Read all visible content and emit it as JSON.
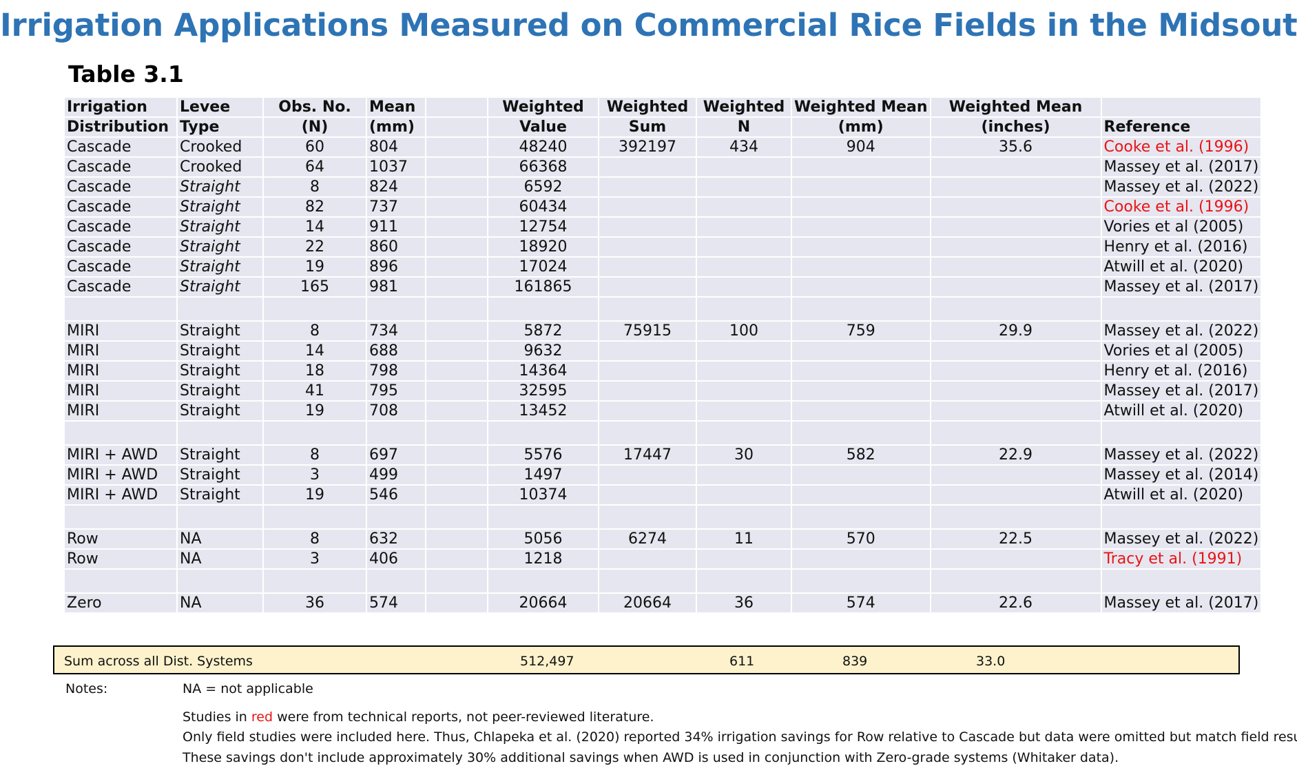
{
  "title": "Irrigation Applications Measured on Commercial Rice Fields in the Midsouth",
  "table_label": "Table 3.1",
  "headers": {
    "row1": [
      "Irrigation",
      "Levee",
      "Obs. No.",
      "Mean",
      "",
      "Weighted",
      "Weighted",
      "Weighted",
      "Weighted Mean",
      "Weighted Mean",
      ""
    ],
    "row2": [
      "Distribution",
      "Type",
      "(N)",
      "(mm)",
      "",
      "Value",
      "Sum",
      "N",
      "(mm)",
      "(inches)",
      "Reference"
    ]
  },
  "rows": [
    {
      "dist": "Cascade",
      "levee": "Crooked",
      "italic": false,
      "n": "60",
      "mean": "804",
      "value": "48240",
      "sum": "392197",
      "wn": "434",
      "wmm": "904",
      "win": "35.6",
      "ref": "Cooke et al. (1996)",
      "red": true
    },
    {
      "dist": "Cascade",
      "levee": "Crooked",
      "italic": false,
      "n": "64",
      "mean": "1037",
      "value": "66368",
      "sum": "",
      "wn": "",
      "wmm": "",
      "win": "",
      "ref": "Massey et al. (2017)",
      "red": false
    },
    {
      "dist": "Cascade",
      "levee": "Straight",
      "italic": true,
      "n": "8",
      "mean": "824",
      "value": "6592",
      "sum": "",
      "wn": "",
      "wmm": "",
      "win": "",
      "ref": "Massey et al. (2022)",
      "red": false
    },
    {
      "dist": "Cascade",
      "levee": "Straight",
      "italic": true,
      "n": "82",
      "mean": "737",
      "value": "60434",
      "sum": "",
      "wn": "",
      "wmm": "",
      "win": "",
      "ref": "Cooke et al. (1996)",
      "red": true
    },
    {
      "dist": "Cascade",
      "levee": "Straight",
      "italic": true,
      "n": "14",
      "mean": "911",
      "value": "12754",
      "sum": "",
      "wn": "",
      "wmm": "",
      "win": "",
      "ref": "Vories et  al (2005)",
      "red": false
    },
    {
      "dist": "Cascade",
      "levee": "Straight",
      "italic": true,
      "n": "22",
      "mean": "860",
      "value": "18920",
      "sum": "",
      "wn": "",
      "wmm": "",
      "win": "",
      "ref": "Henry et al. (2016)",
      "red": false
    },
    {
      "dist": "Cascade",
      "levee": "Straight",
      "italic": true,
      "n": "19",
      "mean": "896",
      "value": "17024",
      "sum": "",
      "wn": "",
      "wmm": "",
      "win": "",
      "ref": "Atwill et al. (2020)",
      "red": false
    },
    {
      "dist": "Cascade",
      "levee": "Straight",
      "italic": true,
      "n": "165",
      "mean": "981",
      "value": "161865",
      "sum": "",
      "wn": "",
      "wmm": "",
      "win": "",
      "ref": "Massey et al. (2017)",
      "red": false
    },
    {
      "blank": true
    },
    {
      "dist": "MIRI",
      "levee": "Straight",
      "italic": false,
      "n": "8",
      "mean": "734",
      "value": "5872",
      "sum": "75915",
      "wn": "100",
      "wmm": "759",
      "win": "29.9",
      "ref": "Massey et al. (2022)",
      "red": false
    },
    {
      "dist": "MIRI",
      "levee": "Straight",
      "italic": false,
      "n": "14",
      "mean": "688",
      "value": "9632",
      "sum": "",
      "wn": "",
      "wmm": "",
      "win": "",
      "ref": "Vories et  al (2005)",
      "red": false
    },
    {
      "dist": "MIRI",
      "levee": "Straight",
      "italic": false,
      "n": "18",
      "mean": "798",
      "value": "14364",
      "sum": "",
      "wn": "",
      "wmm": "",
      "win": "",
      "ref": "Henry et al. (2016)",
      "red": false
    },
    {
      "dist": "MIRI",
      "levee": "Straight",
      "italic": false,
      "n": "41",
      "mean": "795",
      "value": "32595",
      "sum": "",
      "wn": "",
      "wmm": "",
      "win": "",
      "ref": "Massey et al. (2017)",
      "red": false
    },
    {
      "dist": "MIRI",
      "levee": "Straight",
      "italic": false,
      "n": "19",
      "mean": "708",
      "value": "13452",
      "sum": "",
      "wn": "",
      "wmm": "",
      "win": "",
      "ref": "Atwill et al. (2020)",
      "red": false
    },
    {
      "blank": true
    },
    {
      "dist": "MIRI + AWD",
      "levee": "Straight",
      "italic": false,
      "n": "8",
      "mean": "697",
      "value": "5576",
      "sum": "17447",
      "wn": "30",
      "wmm": "582",
      "win": "22.9",
      "ref": "Massey et al. (2022)",
      "red": false
    },
    {
      "dist": "MIRI + AWD",
      "levee": "Straight",
      "italic": false,
      "n": "3",
      "mean": "499",
      "value": "1497",
      "sum": "",
      "wn": "",
      "wmm": "",
      "win": "",
      "ref": "Massey et al. (2014)",
      "red": false
    },
    {
      "dist": "MIRI + AWD",
      "levee": "Straight",
      "italic": false,
      "n": "19",
      "mean": "546",
      "value": "10374",
      "sum": "",
      "wn": "",
      "wmm": "",
      "win": "",
      "ref": "Atwill et al. (2020)",
      "red": false
    },
    {
      "blank": true
    },
    {
      "dist": "Row",
      "levee": "NA",
      "italic": false,
      "n": "8",
      "mean": "632",
      "value": "5056",
      "sum": "6274",
      "wn": "11",
      "wmm": "570",
      "win": "22.5",
      "ref": "Massey et al. (2022)",
      "red": false
    },
    {
      "dist": "Row",
      "levee": "NA",
      "italic": false,
      "n": "3",
      "mean": "406",
      "value": "1218",
      "sum": "",
      "wn": "",
      "wmm": "",
      "win": "",
      "ref": "Tracy et al. (1991)",
      "red": true
    },
    {
      "blank": true
    },
    {
      "dist": "Zero",
      "levee": "NA",
      "italic": false,
      "n": "36",
      "mean": "574",
      "value": "20664",
      "sum": "20664",
      "wn": "36",
      "wmm": "574",
      "win": "22.6",
      "ref": "Massey et al. (2017)",
      "red": false
    }
  ],
  "summary": {
    "label": "Sum across all Dist. Systems",
    "value": "512,497",
    "n": "611",
    "mean_mm": "839",
    "mean_in": "33.0"
  },
  "notes": {
    "label": "Notes:",
    "na": "NA = not applicable",
    "red_pre": "Studies in ",
    "red_word": "red",
    "red_post": " were from technical reports, not peer-reviewed literature.",
    "line2": "Only field studies were included here. Thus, Chlapeka et al. (2020) reported 34% irrigation savings for Row relative to Cascade but data were omitted but match field results.",
    "line3": "These savings don't include approximately 30% additional savings when AWD is used in conjunction with Zero-grade systems (Whitaker data)."
  },
  "colors": {
    "title": "#2e74b5",
    "cell_bg": "#e6e6f0",
    "summary_bg": "#fdf2cc",
    "red": "#e81414"
  }
}
